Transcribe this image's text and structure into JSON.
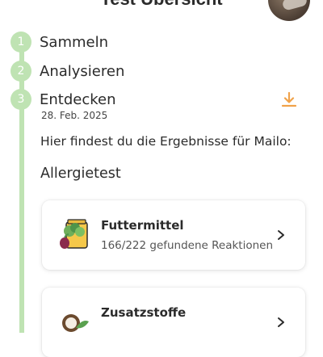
{
  "header": {
    "title": "Test Übersicht"
  },
  "steps": [
    {
      "number": "1",
      "label": "Sammeln"
    },
    {
      "number": "2",
      "label": "Analysieren"
    },
    {
      "number": "3",
      "label": "Entdecken",
      "date": "28. Feb. 2025"
    }
  ],
  "colors": {
    "accent_green": "#bfe3b3",
    "download_orange": "#f0a24a"
  },
  "icons": [
    "download-icon",
    "food-bag-icon",
    "additive-icon",
    "chevron-right-icon"
  ],
  "results": {
    "intro": "Hier findest du die Ergebnisse für Mailo:",
    "section_title": "Allergietest",
    "cards": [
      {
        "title": "Futtermittel",
        "subtitle": "166/222 gefundene Reaktionen"
      },
      {
        "title": "Zusatzstoffe"
      }
    ]
  }
}
